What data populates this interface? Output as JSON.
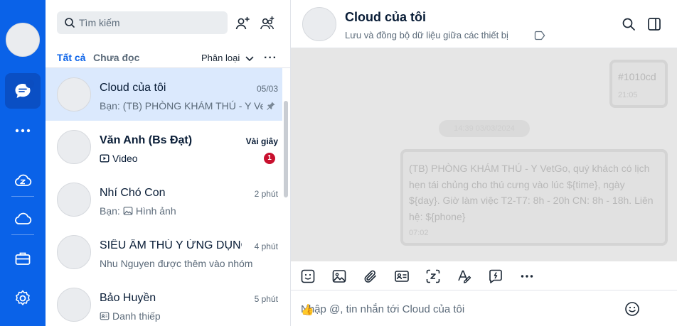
{
  "nav": {
    "items": [
      "messages-icon",
      "more-icon",
      "zcloud-icon",
      "cloud-icon",
      "briefcase-icon",
      "settings-icon"
    ],
    "active": "messages-icon",
    "accent": "#0a62e8"
  },
  "list": {
    "search_placeholder": "Tìm kiếm",
    "tabs": {
      "all": "Tất cả",
      "unread": "Chưa đọc"
    },
    "classify": "Phân loại",
    "more": "···",
    "conversations": [
      {
        "name": "Cloud của tôi",
        "time": "05/03",
        "subtitle": "Bạn: (TB) PHÒNG KHÁM THÚ - Y Vet",
        "pinned": true,
        "selected": true
      },
      {
        "name": "Văn Anh (Bs Đạt)",
        "time": "Vài giây",
        "subtitle": "Video",
        "unread": "1",
        "bold": true
      },
      {
        "name": "Nhí Chó Con",
        "time": "2 phút",
        "subtitle": "Bạn: ",
        "subtitle_extra": "Hình ảnh"
      },
      {
        "name": "SIÊU ÂM THÚ Y ỨNG DỤNG I",
        "time": "4 phút",
        "subtitle": "Nhu Nguyen được thêm vào nhóm"
      },
      {
        "name": "Bảo Huyền",
        "time": "5 phút",
        "subtitle": "Danh thiếp"
      }
    ]
  },
  "chat": {
    "title": "Cloud của tôi",
    "subtitle": "Lưu và đồng bộ dữ liệu giữa các thiết bị",
    "messages": [
      {
        "text": "#1010cd",
        "time": "21:05"
      },
      {
        "text": "(TB) PHÒNG KHÁM THÚ - Y VetGo, quý khách có lịch hẹn tái chủng cho thú cưng vào lúc ${time}, ngày ${day}. Giờ làm việc T2-T7: 8h  - 20h CN: 8h - 18h. Liên hệ: ${phone}",
        "time": "07:02"
      }
    ],
    "date_pill": "14:39 03/03/2024",
    "composer_placeholder": "Nhập @, tin nhắn tới Cloud của tôi",
    "toolbar": [
      "sticker-icon",
      "image-icon",
      "attachment-icon",
      "contact-card-icon",
      "screenshot-icon",
      "text-format-icon",
      "quick-message-icon",
      "more-icon"
    ]
  }
}
